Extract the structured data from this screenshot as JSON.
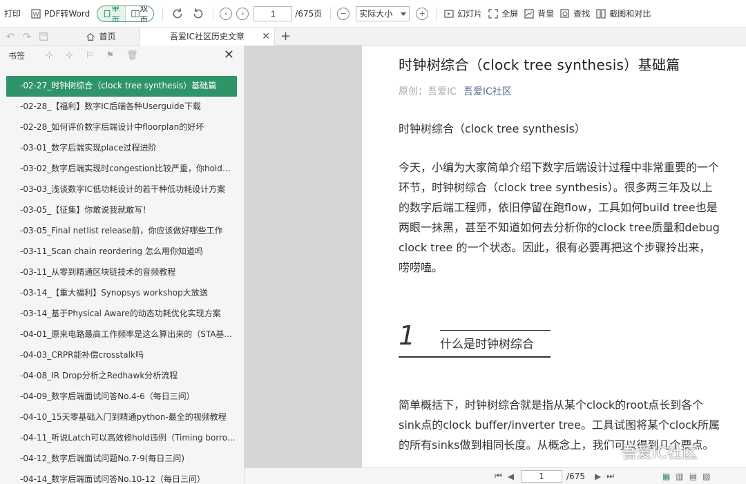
{
  "toolbar": {
    "print": "打印",
    "pdf2word": "PDF转Word",
    "single": "单页",
    "double": "双页",
    "page": "1",
    "total": "/675页",
    "zoom": "实际大小",
    "slides": "幻灯片",
    "fullscreen": "全屏",
    "background": "背景",
    "find": "查找",
    "screenshot": "截图和对比"
  },
  "tabs": {
    "home": "首页",
    "doc": "吾爱IC社区历史文章"
  },
  "sidebar": {
    "title": "书签",
    "items": [
      "-02-27_时钟树综合（clock tree synthesis）基础篇",
      "-02-28_【福利】数字IC后端各种Userguide下载",
      "-02-28_如何评价数字后端设计中floorplan的好坏",
      "-03-01_数字后端实现place过程进阶",
      "-03-02_数字后端实现时congestion比较严重，你hold得...",
      "-03-03_浅谈数字IC低功耗设计的若干种低功耗设计方案",
      "-03-05_【征集】你敢说我就敢写！",
      "-03-05_Final netlist release前，你应该做好哪些工作",
      "-03-11_Scan chain reordering 怎么用你知道吗",
      "-03-11_从零到精通区块链技术的音频教程",
      "-03-14_【重大福利】Synopsys workshop大放送",
      "-03-14_基于Physical Aware的动态功耗优化实现方案",
      "-04-01_原来电路最高工作频率是这么算出来的（STA基...",
      "-04-03_CRPR能补偿crosstalk吗",
      "-04-08_IR Drop分析之Redhawk分析流程",
      "-04-09_数字后端面试问答No.4-6（每日三问）",
      "-04-10_15天零基础入门到精通python-最全的视频教程",
      "-04-11_听说Latch可以高效修hold违例（Timing borro...",
      "-04-12_数字后端面试问题No.7-9(每日三问)",
      "-04-14_数字后端面试问答No.10-12（每日三问）"
    ]
  },
  "doc": {
    "title": "时钟树综合（clock tree synthesis）基础篇",
    "origin": "原创：",
    "author": "吾爱IC",
    "source": "吾爱IC社区",
    "p1": "时钟树综合（clock tree synthesis）",
    "p2": "今天，小编为大家简单介绍下数字后端设计过程中非常重要的一个环节，时钟树综合（clock tree synthesis）。很多两三年及以上的数字后端工程师，依旧停留在跑flow，工具如何build tree也是两眼一抹黑，甚至不知道如何去分析你的clock tree质量和debug clock tree 的一个状态。因此，很有必要再把这个步骤拎出来，唠唠嗑。",
    "sec_num": "1",
    "sec_title": "什么是时钟树综合",
    "p3": "简单概括下，时钟树综合就是指从某个clock的root点长到各个sink点的clock buffer/inverter tree。工具试图将某个clock所属的所有sinks做到相同长度。从概念上，我们可以得到几个要点。"
  },
  "status": {
    "page": "1",
    "total": "/675"
  },
  "watermark": "吾爱IC社区"
}
